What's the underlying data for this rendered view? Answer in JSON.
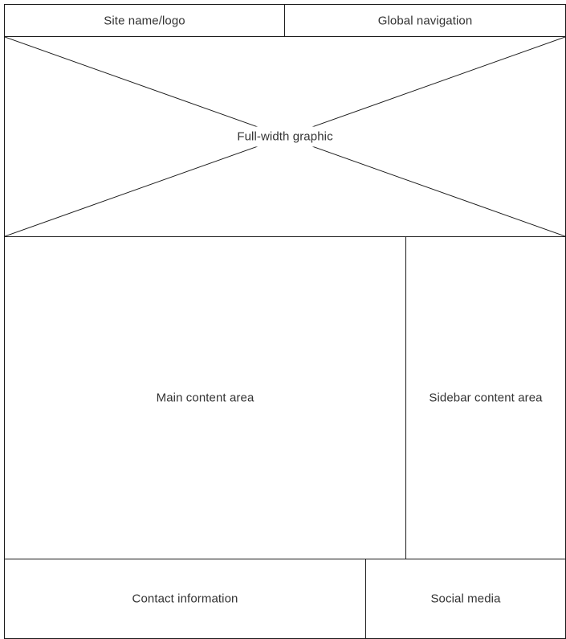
{
  "header": {
    "logo_label": "Site name/logo",
    "nav_label": "Global navigation"
  },
  "hero": {
    "graphic_label": "Full-width graphic"
  },
  "body_sections": {
    "main_label": "Main content area",
    "sidebar_label": "Sidebar content area"
  },
  "footer": {
    "contact_label": "Contact information",
    "social_label": "Social media"
  },
  "colors": {
    "line": "#1a1a1a",
    "text": "#333333",
    "background": "#ffffff"
  }
}
